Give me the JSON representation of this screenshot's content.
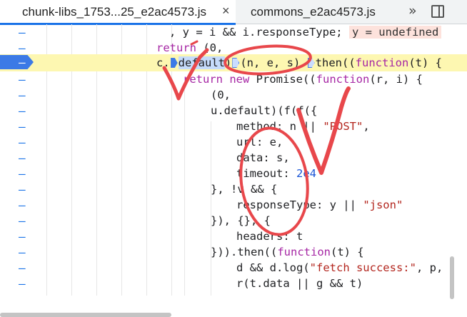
{
  "tabs": [
    {
      "label": "chunk-libs_1753...25_e2ac4573.js",
      "active": true
    },
    {
      "label": "commons_e2ac4573.js",
      "active": false
    }
  ],
  "icons": {
    "close": "×",
    "more": "»",
    "sidebar": "toggle-sidebar-icon"
  },
  "gutter": {
    "marker": "–",
    "current_line": 3
  },
  "code_lines": [
    {
      "indent": 0,
      "parts": [
        ", y = i && i.responseType; "
      ],
      "inline_value": "y = undefined"
    },
    {
      "text": "return (0,"
    },
    {
      "text": "c.default)(n, e, s).then((function(t) {"
    },
    {
      "text": "return new Promise((function(r, i) {"
    },
    {
      "text": "(0,"
    },
    {
      "text": "u.default)(f(f({"
    },
    {
      "text": "method: n || \"POST\","
    },
    {
      "text": "url: e,"
    },
    {
      "text": "data: s,"
    },
    {
      "text": "timeout: 2e4"
    },
    {
      "text": "}, !v && {"
    },
    {
      "text": "responseType: y || \"json\""
    },
    {
      "text": "}), {}, {"
    },
    {
      "text": "headers: t"
    },
    {
      "text": "})).then((function(t) {"
    },
    {
      "text": "d && d.log(\"fetch success:\", p,"
    },
    {
      "text": "r(t.data || g && t)"
    }
  ],
  "tokens": {
    "l0_a": ", y = i && i.responseType; ",
    "l0_val": "y = undefined",
    "l1_kw": "return",
    "l1_b": " (0,",
    "l2_a": "c.",
    "l2_b": "default",
    "l2_c": ")",
    "l2_d": "(n, e, s).",
    "l2_e": "then((",
    "l2_kw": "function",
    "l2_f": "(t) {",
    "l3_kw1": "return new ",
    "l3_b": "Promise((",
    "l3_kw2": "function",
    "l3_c": "(r, i) {",
    "l4": "(0,",
    "l5": "u.default)(f(f({",
    "l6_a": "method: n || ",
    "l6_s": "\"POST\"",
    "l6_b": ",",
    "l7": "url: e,",
    "l8": "data: s,",
    "l9_a": "timeout: ",
    "l9_n": "2e4",
    "l10": "}, !v && {",
    "l11_a": "responseType: y || ",
    "l11_s": "\"json\"",
    "l12": "}), {}, {",
    "l13": "headers: t",
    "l14_a": "})).then((",
    "l14_kw": "function",
    "l14_b": "(t) {",
    "l15_a": "d && d.log(",
    "l15_s": "\"fetch success:\"",
    "l15_b": ", p,",
    "l16": "r(t.data || g && t)"
  },
  "colors": {
    "accent": "#1a73e8",
    "current_line": "#fdf7b1",
    "keyword": "#a626a4",
    "string": "#b3261e",
    "annotation": "#e8474b"
  }
}
